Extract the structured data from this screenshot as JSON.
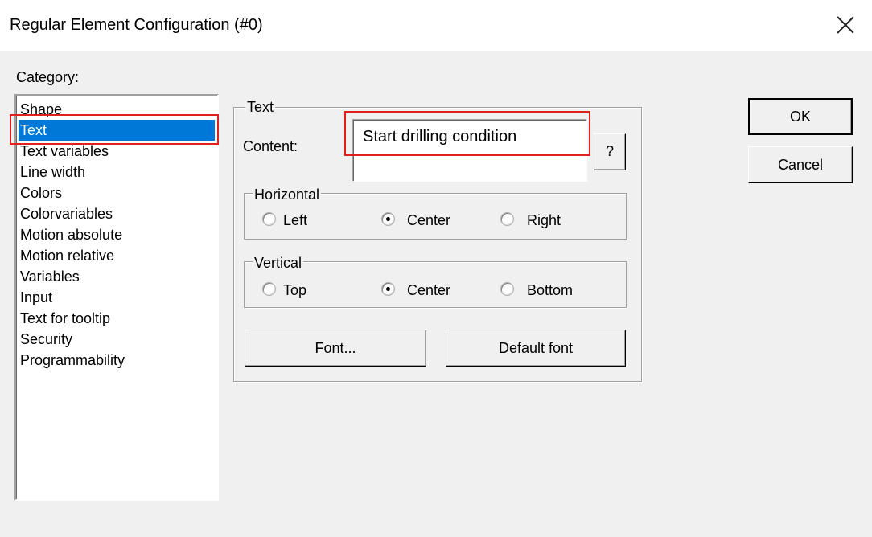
{
  "window": {
    "title": "Regular Element Configuration (#0)",
    "close_icon": "close-icon"
  },
  "category": {
    "label": "Category:",
    "items": [
      "Shape",
      "Text",
      "Text variables",
      "Line width",
      "Colors",
      "Colorvariables",
      "Motion absolute",
      "Motion relative",
      "Variables",
      "Input",
      "Text for tooltip",
      "Security",
      "Programmability"
    ],
    "selected": "Text"
  },
  "text_group": {
    "legend": "Text",
    "content_label": "Content:",
    "content_value": "Start drilling condition",
    "help_button": "?"
  },
  "horizontal": {
    "legend": "Horizontal",
    "options": [
      "Left",
      "Center",
      "Right"
    ],
    "selected": "Center"
  },
  "vertical": {
    "legend": "Vertical",
    "options": [
      "Top",
      "Center",
      "Bottom"
    ],
    "selected": "Center"
  },
  "buttons": {
    "font": "Font...",
    "default_font": "Default font",
    "ok": "OK",
    "cancel": "Cancel"
  },
  "colors": {
    "selection": "#0078d7",
    "highlight": "#e0201c"
  }
}
